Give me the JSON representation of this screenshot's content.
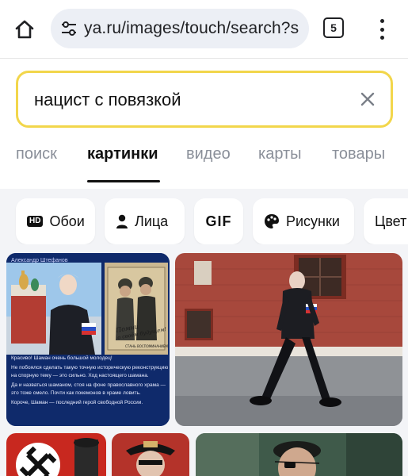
{
  "browser": {
    "url": "ya.ru/images/touch/search?s",
    "tab_count": "5",
    "icons": [
      "home-icon",
      "site-settings-icon",
      "tabs-icon",
      "more-vert-icon"
    ]
  },
  "search": {
    "query": "нацист с повязкой",
    "accent_color": "#f2d64b"
  },
  "service_tabs": [
    {
      "label": "поиск"
    },
    {
      "label": "картинки",
      "active": true
    },
    {
      "label": "видео"
    },
    {
      "label": "карты"
    },
    {
      "label": "товары"
    }
  ],
  "filters": [
    {
      "label": "Обои",
      "icon": "hd-icon",
      "badge": "HD"
    },
    {
      "label": "Лица",
      "icon": "person-icon"
    },
    {
      "label": "GIF"
    },
    {
      "label": "Рисунки",
      "icon": "palette-icon"
    },
    {
      "label": "Цвет"
    }
  ],
  "results": {
    "tile1": {
      "author": "Александр Штефанов",
      "poster_text": "Помни о своём будущем! СТАНЬ ВОСПОМИНАНИЕМ",
      "post_lines": [
        "Красиво! Шаман очень большой молодец!",
        "Не побоялся сделать такую точную историческую реконструкцию на спорную тему — это сильно. Ход настоящего шамана.",
        "Да и назваться шаманом, стоя на фоне православного храма — это тоже смело. Почти как покемонов в храме ловить.",
        "Короче, Шаман — последний герой свободной России."
      ]
    }
  }
}
